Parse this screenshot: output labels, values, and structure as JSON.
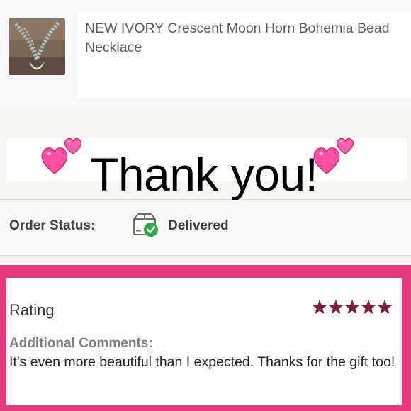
{
  "product": {
    "title": "NEW IVORY Crescent Moon Horn Bohemia Bead Necklace",
    "thumb_icon": "necklace-photo-icon"
  },
  "banner": {
    "text": "Thank you!",
    "heart_icon": "two-hearts-icon",
    "heart_color": "#ff4fa3"
  },
  "order_status": {
    "label": "Order Status:",
    "value": "Delivered",
    "icon": "delivered-box-icon",
    "check_color": "#2eaa4a"
  },
  "rating": {
    "title": "Rating",
    "stars": 5,
    "max_stars": 5,
    "star_color": "#7c1d3a",
    "comments_label": "Additional Comments:",
    "comments": "It's even more beautiful than I expected. Thanks for the gift too!"
  },
  "colors": {
    "frame": "#e23c7c"
  }
}
